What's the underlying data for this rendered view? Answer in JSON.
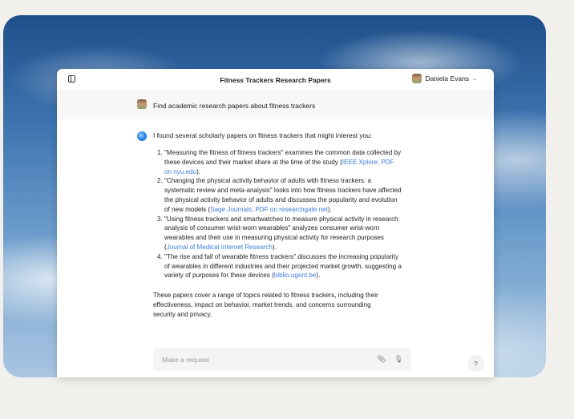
{
  "window": {
    "title": "Fitness Trackers Research Papers"
  },
  "user": {
    "name": "Daniela Evans"
  },
  "prompt": {
    "text": "Find academic research papers about fitness trackers"
  },
  "response": {
    "intro": "I found several scholarly papers on fitness trackers that might interest you:",
    "items": [
      {
        "text": "\"Measuring the fitness of fitness trackers\" examines the common data collected by these devices and their market share at the time of the study (",
        "link": "IEEE Xplore; PDF on nyu.edu",
        "tail": ")."
      },
      {
        "text": "\"Changing the physical activity behavior of adults with fitness trackers: a systematic review and meta-analysis\" looks into how fitness trackers have affected the physical activity behavior of adults and discusses the popularity and evolution of new models (",
        "link": "Sage Journals; PDF on researchgate.net",
        "tail": ")."
      },
      {
        "text": "\"Using fitness trackers and smartwatches to measure physical activity in research: analysis of consumer wrist-worn wearables\" analyzes consumer wrist-worn wearables and their use in measuring physical activity for research purposes (",
        "link": "Journal of Medical Internet Research",
        "tail": ")."
      },
      {
        "text": "\"The rise and fall of wearable fitness trackers\" discusses the increasing popularity of wearables in different industries and their projected market growth, suggesting a variety of purposes for these devices (",
        "link": "biblio.ugent.be",
        "tail": ")."
      }
    ],
    "summary": "These papers cover a range of topics related to fitness trackers, including their effectiveness, impact on behavior, market trends, and concerns surrounding security and privacy."
  },
  "input": {
    "placeholder": "Make a request"
  },
  "help": {
    "label": "?"
  },
  "colors": {
    "link": "#3b7ddd",
    "window_bg": "#ffffff",
    "prompt_bg": "#f7f7f7"
  },
  "icons": {
    "sidebar": "sidebar-toggle-icon",
    "attach": "paperclip-icon",
    "mic": "microphone-icon",
    "assistant": "assistant-logo-icon"
  }
}
